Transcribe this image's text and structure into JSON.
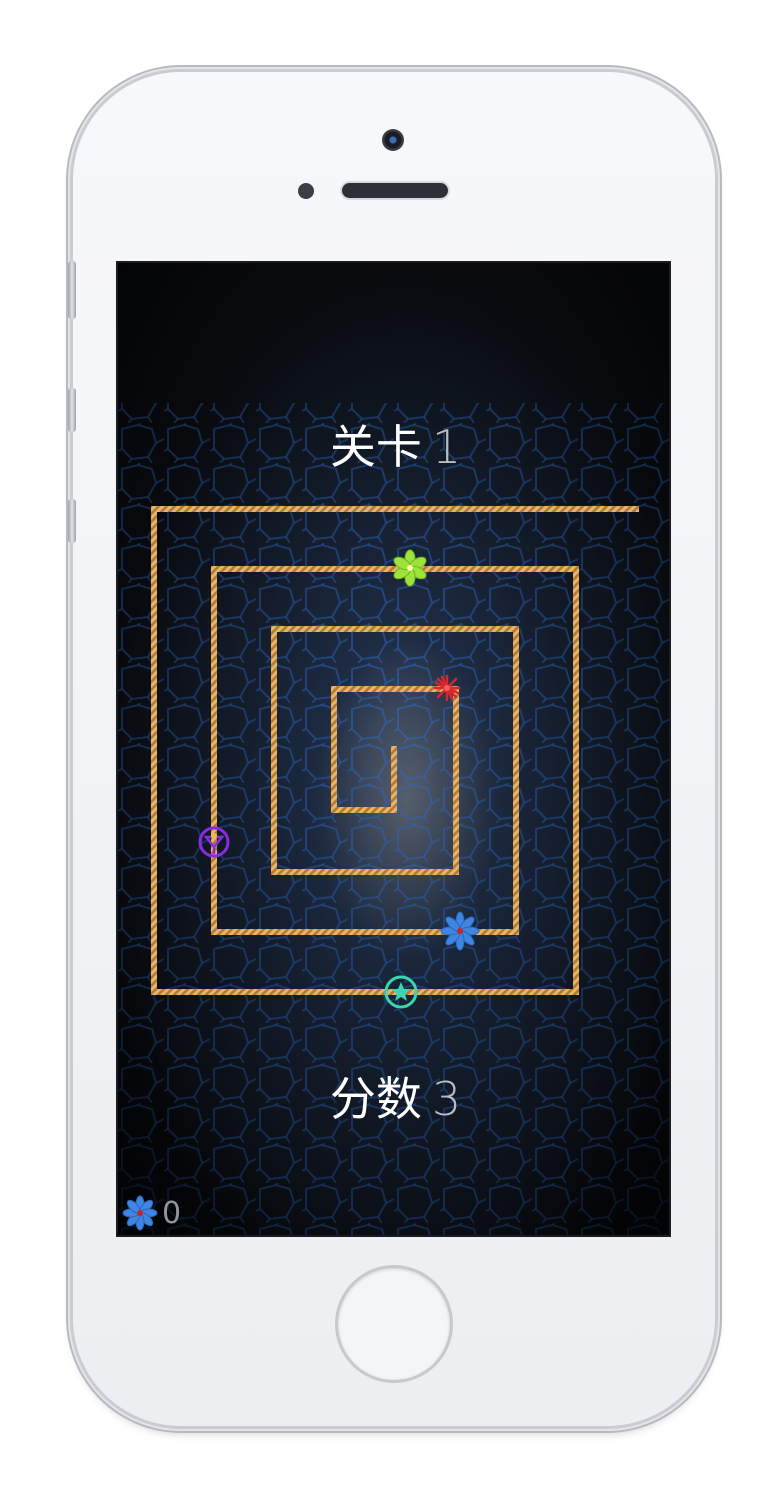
{
  "game": {
    "level_label": "关卡",
    "level_value": "1",
    "score_label": "分数",
    "score_value": "3",
    "collected_count": "0"
  },
  "colors": {
    "rope": "#c8913f",
    "background_glow": "#2d5fae",
    "green_flower": "#9ee33a",
    "red_star": "#d8262b",
    "blue_flower": "#3f86e3",
    "purple_ring": "#8a2be2",
    "teal_ring": "#3ad6b0"
  },
  "icons": {
    "green_flower": "pinwheel-flower-icon",
    "red_star": "spiky-star-icon",
    "blue_flower": "flower-icon",
    "purple_ring": "ring-enemy-icon",
    "teal_ring": "star-ring-player-icon",
    "counter_icon": "flower-icon"
  }
}
